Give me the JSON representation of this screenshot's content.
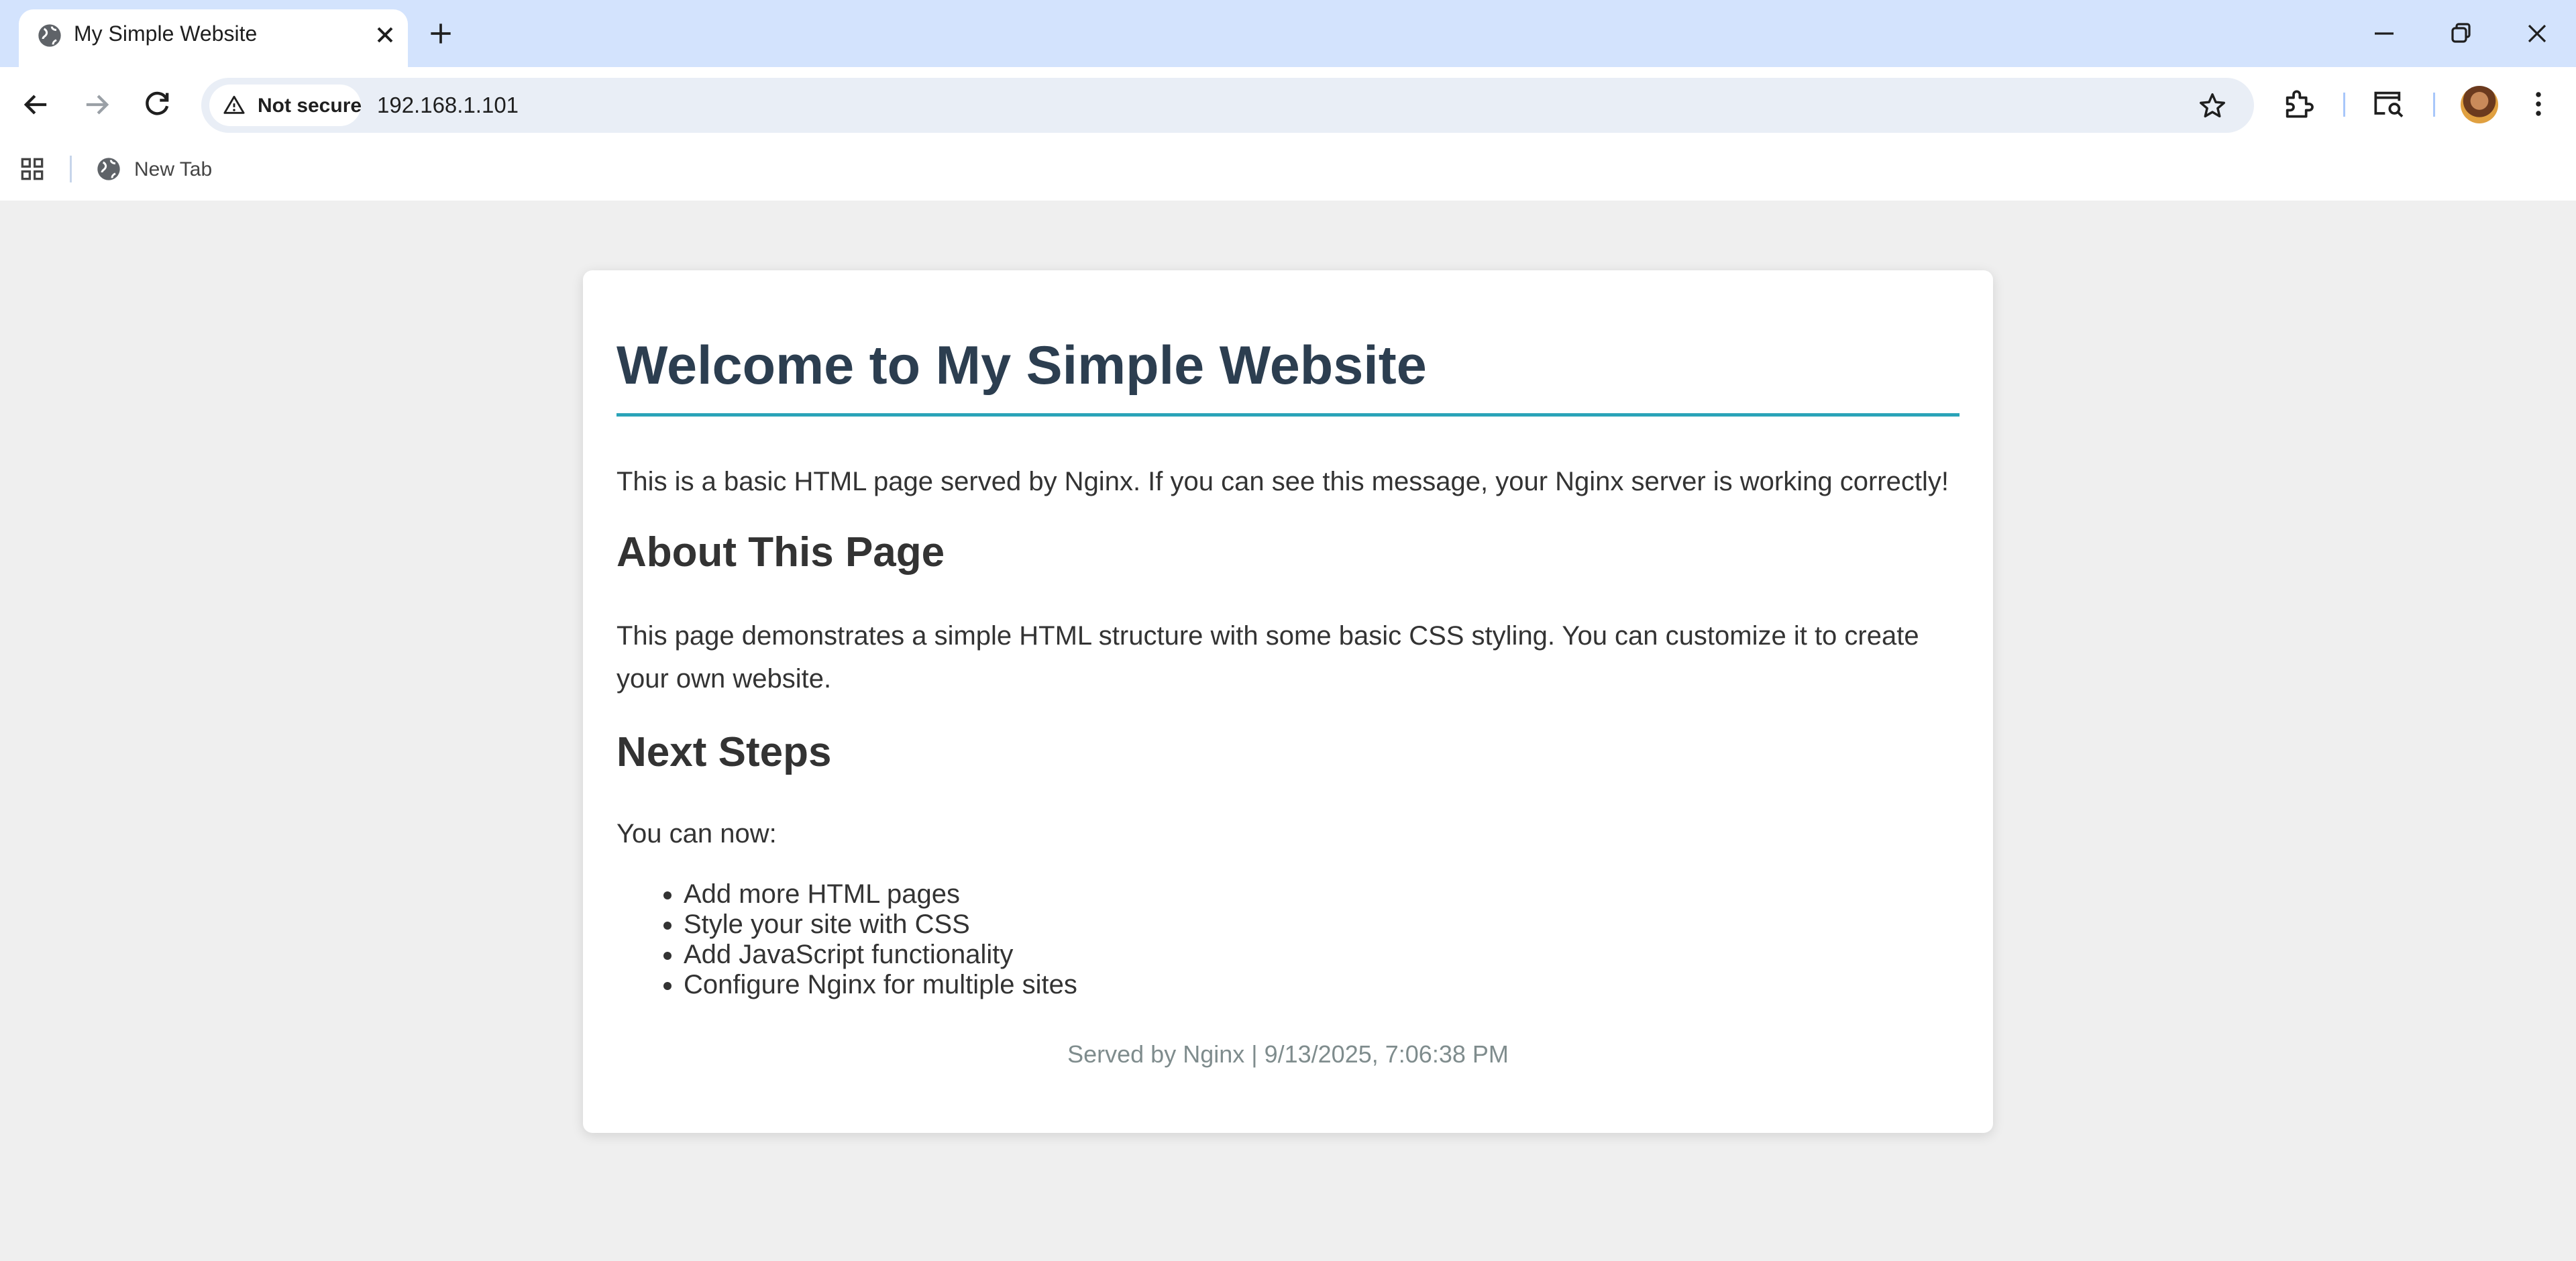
{
  "browser": {
    "tab_title": "My Simple Website",
    "security_label": "Not secure",
    "url": "192.168.1.101",
    "bookmark_newtab": "New Tab",
    "tab_bg": "#d3e3fd"
  },
  "page": {
    "heading": "Welcome to My Simple Website",
    "intro": "This is a basic HTML page served by Nginx. If you can see this message, your Nginx server is working correctly!",
    "about_heading": "About This Page",
    "about_text": "This page demonstrates a simple HTML structure with some basic CSS styling. You can customize it to create your own website.",
    "next_heading": "Next Steps",
    "next_intro": "You can now:",
    "steps": [
      "Add more HTML pages",
      "Style your site with CSS",
      "Add JavaScript functionality",
      "Configure Nginx for multiple sites"
    ],
    "footer": "Served by Nginx | 9/13/2025, 7:06:38 PM",
    "heading_color": "#2c3e50",
    "accent_color": "#2aa3b8"
  }
}
